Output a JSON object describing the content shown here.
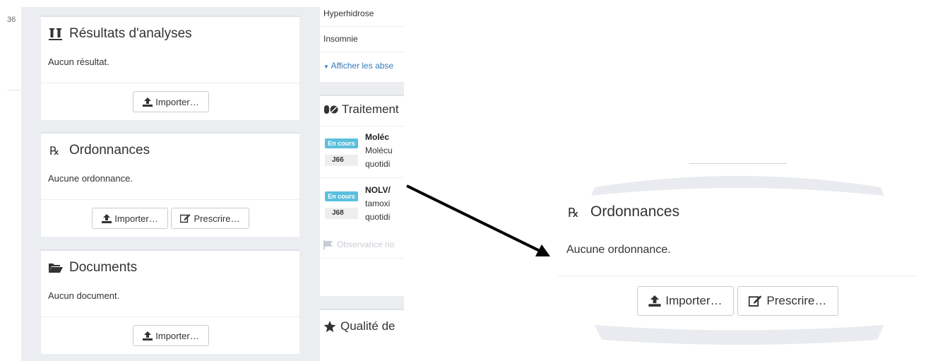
{
  "left_strip": {
    "number": "36"
  },
  "cards": {
    "results": {
      "title": "Résultats d'analyses",
      "empty": "Aucun résultat.",
      "import_label": "Importer…"
    },
    "ordonnances": {
      "title": "Ordonnances",
      "empty": "Aucune ordonnance.",
      "import_label": "Importer…",
      "prescribe_label": "Prescrire…"
    },
    "documents": {
      "title": "Documents",
      "empty": "Aucun document.",
      "import_label": "Importer…"
    }
  },
  "middle": {
    "conditions": [
      "Hyperhidrose",
      "Insomnie"
    ],
    "show_absent": "Afficher les abse",
    "treatments_title": "Traitement",
    "treatments": [
      {
        "status": "En cours",
        "day": "J66",
        "name": "Moléc",
        "line1": "Molécu",
        "line2": "quotidi"
      },
      {
        "status": "En cours",
        "day": "J68",
        "name": "NOLV/",
        "line1": "tamoxi",
        "line2": "quotidi"
      }
    ],
    "observance": "Observance no",
    "quality_title": "Qualité de"
  },
  "zoom": {
    "title": "Ordonnances",
    "empty": "Aucune ordonnance.",
    "import_label": "Importer…",
    "prescribe_label": "Prescrire…"
  },
  "colors": {
    "accent": "#337ab7",
    "badge": "#5bc0de",
    "panel_bg": "#ebedf1"
  }
}
